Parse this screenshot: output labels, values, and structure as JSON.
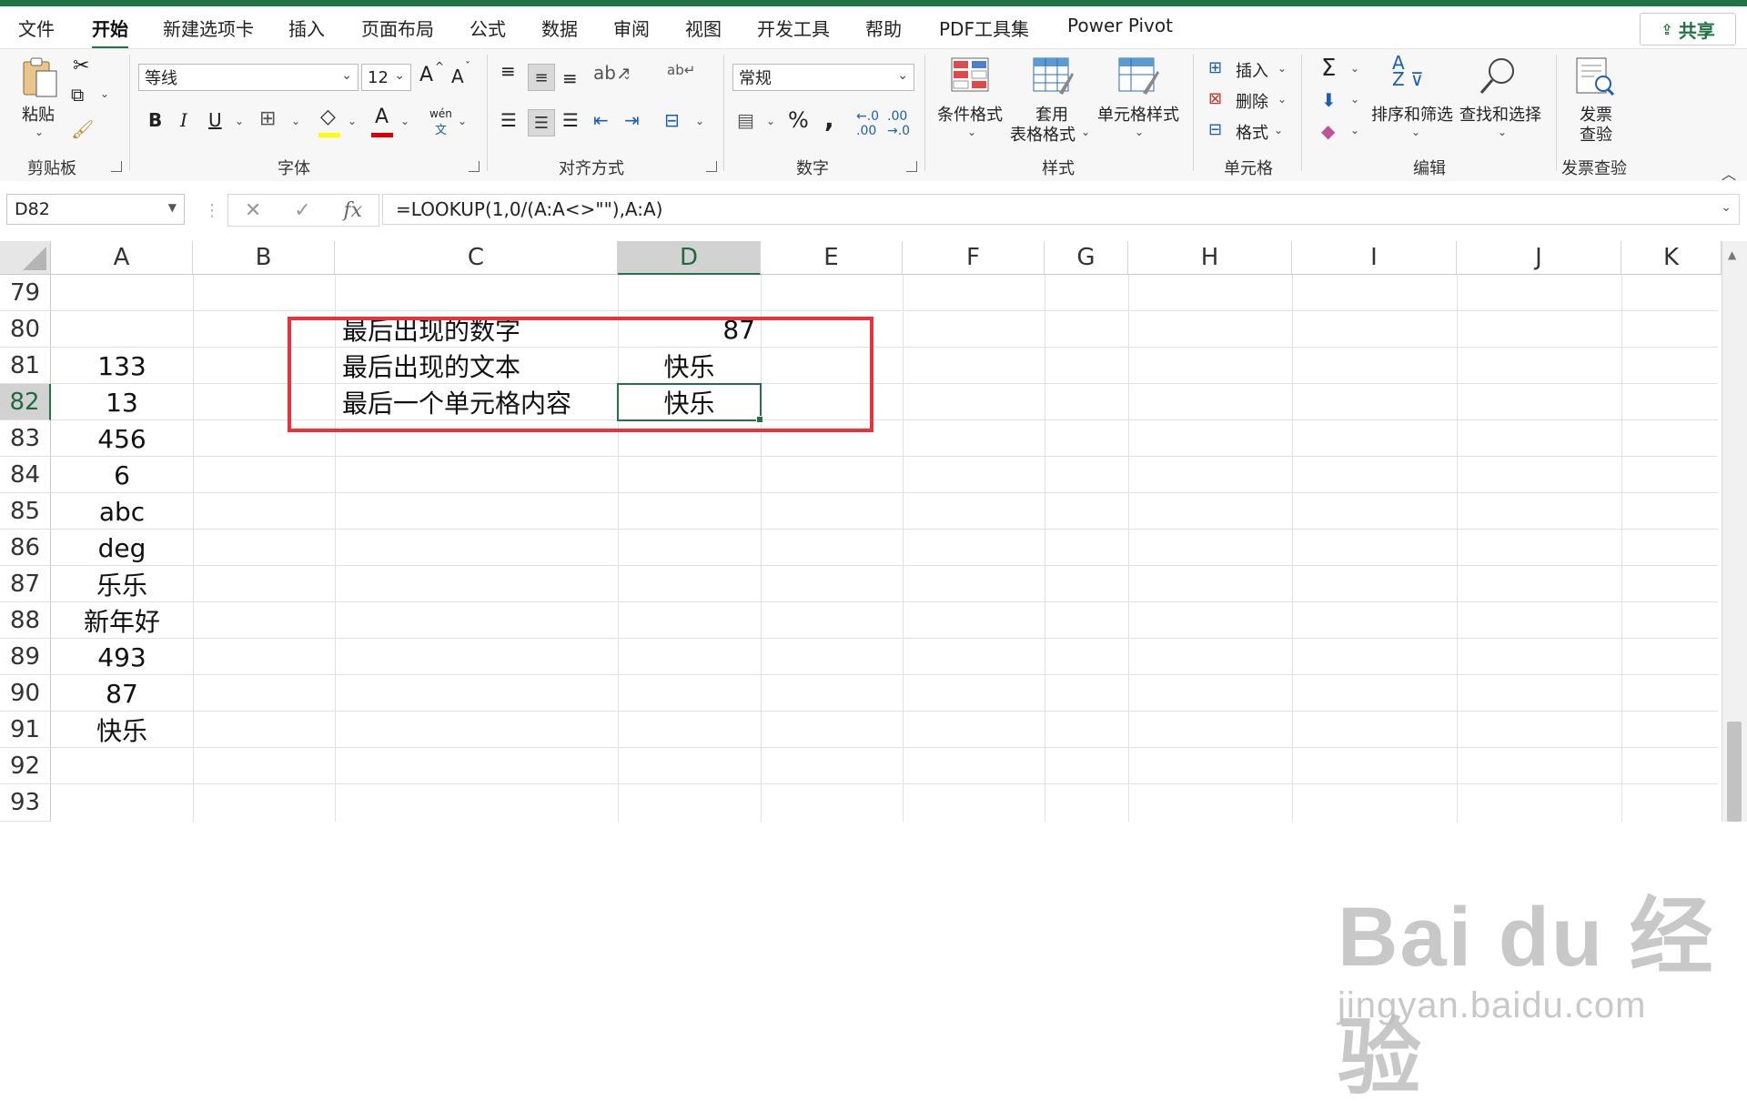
{
  "tabs": [
    "文件",
    "开始",
    "新建选项卡",
    "插入",
    "页面布局",
    "公式",
    "数据",
    "审阅",
    "视图",
    "开发工具",
    "帮助",
    "PDF工具集",
    "Power Pivot"
  ],
  "active_tab": "开始",
  "share_label": "共享",
  "ribbon": {
    "clipboard": {
      "paste_label": "粘贴",
      "group_label": "剪贴板"
    },
    "font": {
      "font_name": "等线",
      "font_size": "12",
      "group_label": "字体",
      "bold": "B",
      "italic": "I",
      "underline": "U",
      "grow": "A",
      "shrink": "A",
      "phonetic_top": "wén",
      "phonetic_bottom": "文"
    },
    "alignment": {
      "group_label": "对齐方式"
    },
    "number": {
      "format": "常规",
      "group_label": "数字",
      "percent": "%",
      "comma": ","
    },
    "styles": {
      "conditional": "条件格式",
      "table_top": "套用",
      "table_bottom": "表格格式",
      "cell_styles": "单元格样式",
      "group_label": "样式"
    },
    "cells": {
      "insert": "插入",
      "delete": "删除",
      "format": "格式",
      "group_label": "单元格"
    },
    "editing": {
      "sum": "Σ",
      "sort_filter": "排序和筛选",
      "find_select": "查找和选择",
      "group_label": "编辑"
    },
    "invoice": {
      "top": "发票",
      "bottom": "查验",
      "group_label": "发票查验"
    }
  },
  "formula_bar": {
    "name_box": "D82",
    "formula": "=LOOKUP(1,0/(A:A<>\"\"),A:A)"
  },
  "columns": [
    "A",
    "B",
    "C",
    "D",
    "E",
    "F",
    "G",
    "H",
    "I",
    "J",
    "K"
  ],
  "selected_column": "D",
  "rows": [
    "79",
    "80",
    "81",
    "82",
    "83",
    "84",
    "85",
    "86",
    "87",
    "88",
    "89",
    "90",
    "91",
    "92",
    "93"
  ],
  "selected_row": "82",
  "cells": {
    "A81": "133",
    "A82": "13",
    "A83": "456",
    "A84": "6",
    "A85": "abc",
    "A86": "deg",
    "A87": "乐乐",
    "A88": "新年好",
    "A89": "493",
    "A90": "87",
    "A91": "快乐",
    "C80": "最后出现的数字",
    "C81": "最后出现的文本",
    "C82": "最后一个单元格内容",
    "D80": "87",
    "D81": "快乐",
    "D82": "快乐"
  },
  "watermark": {
    "brand": "Bai du 经验",
    "url": "jingyan.baidu.com"
  },
  "colors": {
    "accent": "#217346",
    "highlight_box": "#e8333a"
  }
}
